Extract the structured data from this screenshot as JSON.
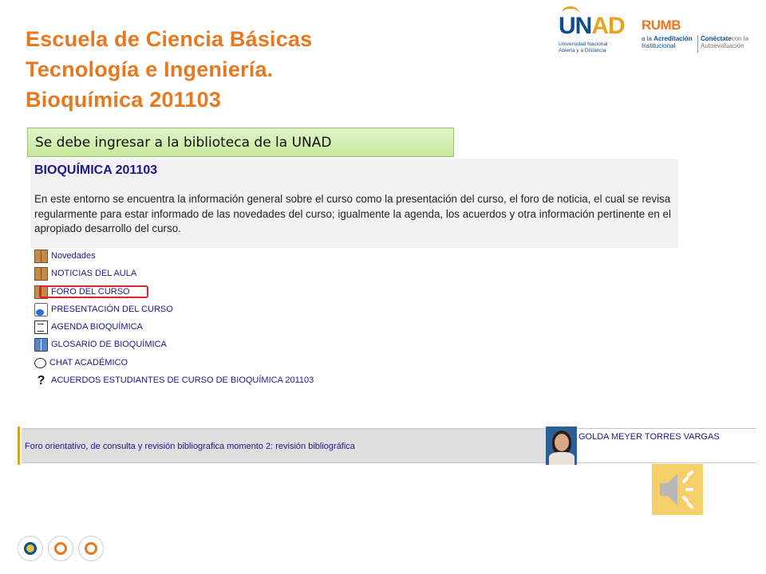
{
  "slide": {
    "title_lines": [
      "Escuela de  Ciencia Básicas",
      "Tecnología e Ingeniería.",
      "Bioquímica 201103"
    ],
    "callout": "Se debe ingresar a la biblioteca de la UNAD"
  },
  "logos": {
    "unad_word_main": "UN",
    "unad_word_accent": "AD",
    "unad_sub_1": "Universidad Nacional",
    "unad_sub_2": "Abierta y a Distancia",
    "rumbo_word": "RUMB",
    "rumbo_sub_a": "a la ",
    "rumbo_sub_b": "Acreditación",
    "rumbo_sub_c": "Institucional",
    "conectate_a": "Conéctate",
    "conectate_b": "con la",
    "conectate_c": "Autoevaluación"
  },
  "course": {
    "heading": "BIOQUÍMICA 201103",
    "description": "En este entorno se encuentra la información general sobre el curso como la presentación del curso, el foro de noticia, el cual se revisa regularmente para estar informado de las novedades del curso; igualmente la agenda, los acuerdos y otra información pertinente en el apropiado desarrollo del curso.",
    "activities": [
      {
        "label": "Novedades",
        "icon": "forum-icon"
      },
      {
        "label": "NOTICIAS DEL AULA",
        "icon": "forum-icon"
      },
      {
        "label": "FORO DEL CURSO",
        "icon": "forum-icon"
      },
      {
        "label": "PRESENTACIÓN DEL CURSO",
        "icon": "resource-icon"
      },
      {
        "label": "AGENDA BIOQUÍMICA",
        "icon": "document-icon"
      },
      {
        "label": "GLOSARIO DE BIOQUÍMICA",
        "icon": "glossary-icon"
      },
      {
        "label": "CHAT ACADÉMICO",
        "icon": "chat-icon"
      },
      {
        "label": "ACUERDOS ESTUDIANTES DE CURSO DE BIOQUÍMICA 201103",
        "icon": "question-icon"
      }
    ]
  },
  "forum_post": {
    "title": "Foro orientativo, de consulta y revisión bibliografica momento 2: revisión bibliográfica",
    "author": "GOLDA MEYER TORRES VARGAS"
  },
  "colors": {
    "title": "#e8781e",
    "link": "#1a1a8c",
    "callout_bg": "#d3eeb2",
    "highlight": "#e2222a"
  }
}
